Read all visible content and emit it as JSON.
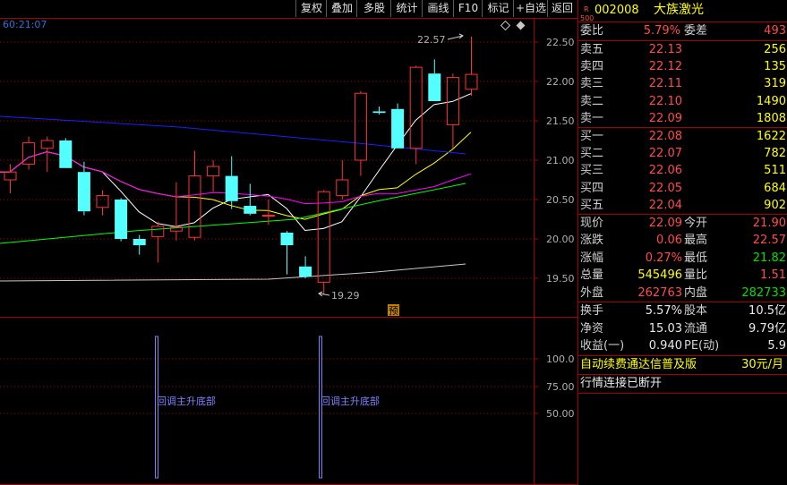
{
  "toolbar": {
    "buttons": [
      "复权",
      "叠加",
      "多股",
      "统计",
      "画线",
      "F10",
      "标记",
      "+自选",
      "返回"
    ]
  },
  "chart": {
    "timestamp": "60:21:07",
    "price_axis": [
      "22.50",
      "22.00",
      "21.50",
      "21.00",
      "20.50",
      "20.00",
      "19.50"
    ],
    "high_label": "22.57",
    "low_label": "19.29",
    "pred_badge": "预",
    "lower_axis": [
      "100.0",
      "75.00",
      "50.00"
    ],
    "signal_labels": [
      "回调主升底部",
      "回调主升底部"
    ],
    "colors": {
      "up": "#ff3232",
      "down": "#54ffff",
      "ma5": "#ffffff",
      "ma10": "#ffff00",
      "ma20": "#ff00ff",
      "ma30": "#00ff00",
      "ma60": "#1e1eff"
    }
  },
  "chart_data": {
    "type": "candlestick",
    "candles": [
      {
        "o": 20.75,
        "h": 20.95,
        "l": 20.58,
        "c": 20.85
      },
      {
        "o": 20.95,
        "h": 21.3,
        "l": 20.88,
        "c": 21.22
      },
      {
        "o": 21.15,
        "h": 21.3,
        "l": 20.85,
        "c": 21.25
      },
      {
        "o": 21.25,
        "h": 21.28,
        "l": 20.9,
        "c": 20.9
      },
      {
        "o": 20.85,
        "h": 20.98,
        "l": 20.3,
        "c": 20.35
      },
      {
        "o": 20.4,
        "h": 20.62,
        "l": 20.3,
        "c": 20.55
      },
      {
        "o": 20.5,
        "h": 20.52,
        "l": 19.97,
        "c": 20.0
      },
      {
        "o": 20.0,
        "h": 20.05,
        "l": 19.8,
        "c": 19.92
      },
      {
        "o": 20.03,
        "h": 20.22,
        "l": 19.7,
        "c": 20.16
      },
      {
        "o": 20.1,
        "h": 20.72,
        "l": 19.98,
        "c": 20.15
      },
      {
        "o": 20.02,
        "h": 21.12,
        "l": 19.98,
        "c": 20.8
      },
      {
        "o": 20.8,
        "h": 21.0,
        "l": 20.6,
        "c": 20.92
      },
      {
        "o": 20.8,
        "h": 21.05,
        "l": 20.38,
        "c": 20.48
      },
      {
        "o": 20.42,
        "h": 20.7,
        "l": 20.3,
        "c": 20.32
      },
      {
        "o": 20.3,
        "h": 20.5,
        "l": 20.18,
        "c": 20.3
      },
      {
        "o": 20.08,
        "h": 20.1,
        "l": 19.55,
        "c": 19.92
      },
      {
        "o": 19.65,
        "h": 19.78,
        "l": 19.5,
        "c": 19.52
      },
      {
        "o": 19.45,
        "h": 20.62,
        "l": 19.29,
        "c": 20.6
      },
      {
        "o": 20.55,
        "h": 21.0,
        "l": 20.5,
        "c": 20.75
      },
      {
        "o": 21.0,
        "h": 21.88,
        "l": 20.8,
        "c": 21.85
      },
      {
        "o": 21.62,
        "h": 21.68,
        "l": 21.58,
        "c": 21.6
      },
      {
        "o": 21.65,
        "h": 21.72,
        "l": 21.15,
        "c": 21.15
      },
      {
        "o": 21.15,
        "h": 22.2,
        "l": 20.95,
        "c": 22.18
      },
      {
        "o": 22.1,
        "h": 22.28,
        "l": 21.8,
        "c": 21.75
      },
      {
        "o": 21.45,
        "h": 22.1,
        "l": 21.15,
        "c": 22.05
      },
      {
        "o": 21.9,
        "h": 22.57,
        "l": 21.82,
        "c": 22.09
      }
    ],
    "ylim": [
      19.29,
      22.57
    ]
  },
  "quote": {
    "code": "002008",
    "name": "大族激光",
    "badge_top": "R",
    "badge_bottom": "500",
    "weibi_label": "委比",
    "weibi": "5.79%",
    "weicha_label": "委差",
    "weicha": "493",
    "asks": [
      {
        "label": "卖五",
        "price": "22.13",
        "vol": "256"
      },
      {
        "label": "卖四",
        "price": "22.12",
        "vol": "135"
      },
      {
        "label": "卖三",
        "price": "22.11",
        "vol": "319"
      },
      {
        "label": "卖二",
        "price": "22.10",
        "vol": "1490"
      },
      {
        "label": "卖一",
        "price": "22.09",
        "vol": "1808"
      }
    ],
    "bids": [
      {
        "label": "买一",
        "price": "22.08",
        "vol": "1622"
      },
      {
        "label": "买二",
        "price": "22.07",
        "vol": "782"
      },
      {
        "label": "买三",
        "price": "22.06",
        "vol": "511"
      },
      {
        "label": "买四",
        "price": "22.05",
        "vol": "684"
      },
      {
        "label": "买五",
        "price": "22.04",
        "vol": "902"
      }
    ],
    "stats": [
      {
        "l1": "现价",
        "v1": "22.09",
        "c1": "red",
        "l2": "今开",
        "v2": "21.90",
        "c2": "red"
      },
      {
        "l1": "涨跌",
        "v1": "0.06",
        "c1": "red",
        "l2": "最高",
        "v2": "22.57",
        "c2": "red"
      },
      {
        "l1": "涨幅",
        "v1": "0.27%",
        "c1": "red",
        "l2": "最低",
        "v2": "21.82",
        "c2": "green"
      },
      {
        "l1": "总量",
        "v1": "545496",
        "c1": "yellow",
        "l2": "量比",
        "v2": "1.51",
        "c2": "red"
      },
      {
        "l1": "外盘",
        "v1": "262763",
        "c1": "red",
        "l2": "内盘",
        "v2": "282733",
        "c2": "green"
      }
    ],
    "fin": [
      {
        "l1": "换手",
        "v1": "5.57%",
        "l2": "股本",
        "v2": "10.5亿"
      },
      {
        "l1": "净资",
        "v1": "15.03",
        "l2": "流通",
        "v2": "9.79亿"
      },
      {
        "l1": "收益(一)",
        "v1": "0.940",
        "l2": "PE(动)",
        "v2": "5.9"
      }
    ],
    "promo": "自动续费通达信普及版",
    "promo_price": "30元/月",
    "status": "行情连接已断开"
  }
}
